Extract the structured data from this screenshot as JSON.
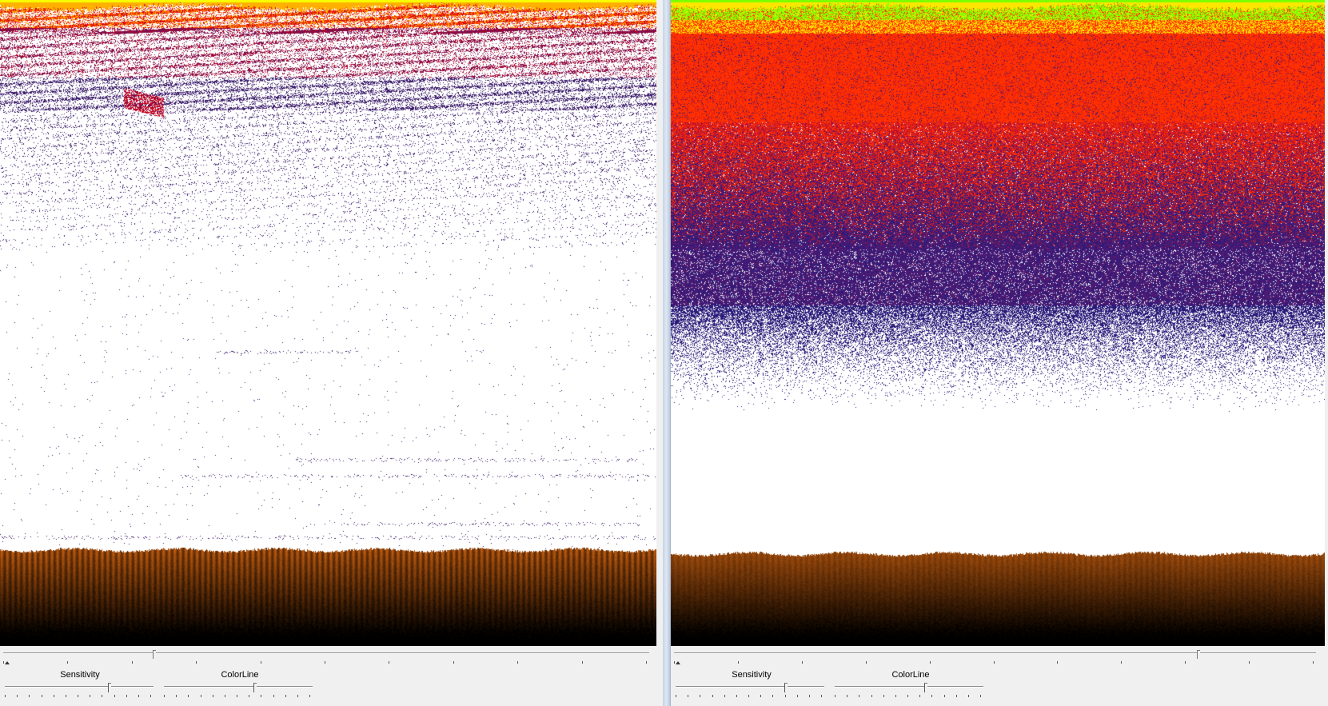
{
  "panels": [
    {
      "id": "left",
      "sensitivity_label": "Sensitivity",
      "colorline_label": "ColorLine",
      "surface_colors": [
        "#f8ff00",
        "#ffb000",
        "#ff3000",
        "#c00020",
        "#7a1050",
        "#3a1a6a"
      ],
      "bottom_color": "#c0651c"
    },
    {
      "id": "right",
      "sensitivity_label": "Sensitivity",
      "colorline_label": "ColorLine",
      "surface_colors": [
        "#7cff00",
        "#ffe600",
        "#ff3000",
        "#c01030",
        "#5a1a70",
        "#2a1a7a"
      ],
      "bottom_color": "#c0651c"
    }
  ]
}
